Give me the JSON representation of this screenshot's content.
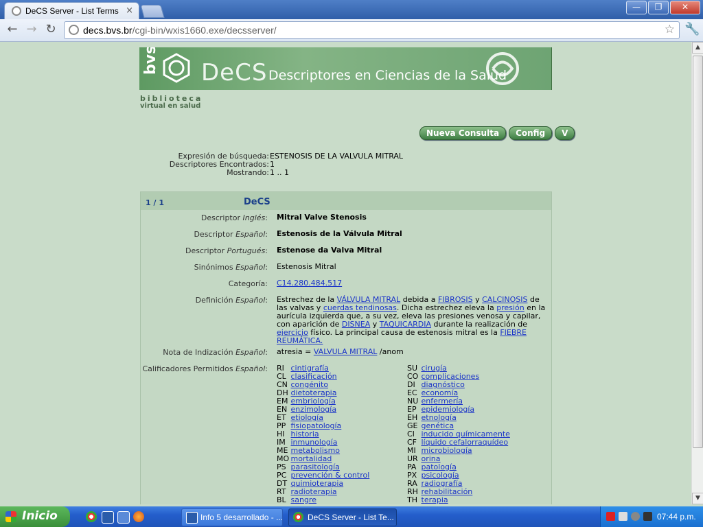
{
  "browser": {
    "tab_title": "DeCS Server - List Terms",
    "tab_close": "×",
    "url_host": "decs.bvs.br",
    "url_path": "/cgi-bin/wxis1660.exe/decsserver/",
    "window_buttons": {
      "minimize": "—",
      "maximize": "❐",
      "close": "✕"
    }
  },
  "header": {
    "logo_vertical": "bvs",
    "brand": "DeCS",
    "subtitle": "Descriptores en Ciencias de la Salud",
    "bib_line1": "biblioteca",
    "bib_line2": "virtual en salud"
  },
  "actions": {
    "nueva": "Nueva Consulta",
    "config": "Config",
    "v": "V"
  },
  "summary": {
    "labels": [
      "Expresión de búsqueda:",
      "Descriptores Encontrados:",
      "Mostrando:"
    ],
    "values": [
      "ESTENOSIS DE LA VALVULA MITRAL",
      "1",
      "1 .. 1"
    ]
  },
  "panel": {
    "count": "1 / 1",
    "title": "DeCS",
    "desc_ingles_label": "Descriptor",
    "desc_ingles_lang": "Inglés",
    "desc_ingles": "Mitral Valve Stenosis",
    "desc_espanol_label": "Descriptor",
    "desc_espanol_lang": "Español",
    "desc_espanol": "Estenosis de la Válvula Mitral",
    "desc_portugues_label": "Descriptor",
    "desc_portugues_lang": "Portugués",
    "desc_portugues": "Estenose da Valva Mitral",
    "sinonimos_label": "Sinónimos",
    "sinonimos_lang": "Español",
    "sinonimos": "Estenosis Mitral",
    "categoria_label": "Categoría:",
    "categoria": "C14.280.484.517",
    "definicion_label": "Definición",
    "definicion_lang": "Español",
    "def": {
      "t1": "Estrechez de la ",
      "l1": "VÁLVULA MITRAL",
      "t2": " debida a ",
      "l2": "FIBROSIS",
      "t3": " y ",
      "l3": "CALCINOSIS",
      "t4": " de las valvas y ",
      "l4": "cuerdas tendinosas",
      "t5": ". Dicha estrechez eleva la ",
      "l5": "presión",
      "t6": " en la aurícula izquierda que, a su vez, eleva las presiones venosa y capilar, con aparición de ",
      "l6": "DISNEA",
      "t7": " y ",
      "l7": "TAQUICARDIA",
      "t8": " durante la realización de ",
      "l8": "ejercicio",
      "t9": " físico. La principal causa de estenosis mitral es la ",
      "l9": "FIEBRE REUMÁTICA."
    },
    "nota_label": "Nota de Indización",
    "nota_lang": "Español",
    "nota_t1": "atresia = ",
    "nota_link": "VALVULA MITRAL",
    "nota_t2": " /anom",
    "calif_label": "Calificadores Permitidos",
    "calif_lang": "Español"
  },
  "qualifiers_left": [
    {
      "code": "RI",
      "term": "cintigrafía"
    },
    {
      "code": "CL",
      "term": "clasificación"
    },
    {
      "code": "CN",
      "term": "congénito"
    },
    {
      "code": "DH",
      "term": "dietoterapia"
    },
    {
      "code": "EM",
      "term": "embriología"
    },
    {
      "code": "EN",
      "term": "enzimología"
    },
    {
      "code": "ET",
      "term": "etiología"
    },
    {
      "code": "PP",
      "term": "fisiopatología"
    },
    {
      "code": "HI",
      "term": "historia"
    },
    {
      "code": "IM",
      "term": "inmunología"
    },
    {
      "code": "ME",
      "term": "metabolismo"
    },
    {
      "code": "MO",
      "term": "mortalidad"
    },
    {
      "code": "PS",
      "term": "parasitología"
    },
    {
      "code": "PC",
      "term": "prevención & control"
    },
    {
      "code": "DT",
      "term": "quimioterapia"
    },
    {
      "code": "RT",
      "term": "radioterapia"
    },
    {
      "code": "BL",
      "term": "sangre"
    }
  ],
  "qualifiers_right": [
    {
      "code": "SU",
      "term": "cirugía"
    },
    {
      "code": "CO",
      "term": "complicaciones"
    },
    {
      "code": "DI",
      "term": "diagnóstico"
    },
    {
      "code": "EC",
      "term": "economía"
    },
    {
      "code": "NU",
      "term": "enfermería"
    },
    {
      "code": "EP",
      "term": "epidemiología"
    },
    {
      "code": "EH",
      "term": "etnología"
    },
    {
      "code": "GE",
      "term": "genética"
    },
    {
      "code": "CI",
      "term": "inducido químicamente"
    },
    {
      "code": "CF",
      "term": "líquido cefalorraquídeo"
    },
    {
      "code": "MI",
      "term": "microbiología"
    },
    {
      "code": "UR",
      "term": "orina"
    },
    {
      "code": "PA",
      "term": "patología"
    },
    {
      "code": "PX",
      "term": "psicología"
    },
    {
      "code": "RA",
      "term": "radiografía"
    },
    {
      "code": "RH",
      "term": "rehabilitación"
    },
    {
      "code": "TH",
      "term": "terapia"
    }
  ],
  "taskbar": {
    "start": "Inicio",
    "task1": "Info 5 desarrollado - ...",
    "task2": "DeCS Server - List Te...",
    "clock": "07:44 p.m."
  }
}
